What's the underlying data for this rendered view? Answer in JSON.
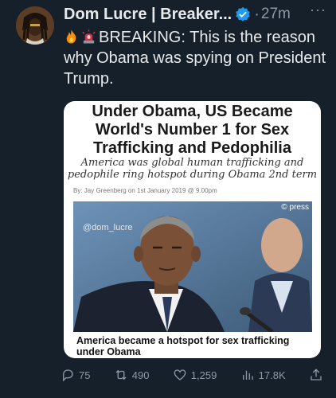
{
  "author": {
    "display_name": "Dom Lucre | Breaker...",
    "time": "27m"
  },
  "tweet": {
    "text": "BREAKING: This is the reason why Obama was spying on President Trump."
  },
  "card": {
    "headline": "Under Obama, US Became World's Number 1 for Sex Trafficking and Pedophilia",
    "subheadline": "America was global human trafficking and pedophile ring hotspot during Obama 2nd term",
    "byline": "By: Jay Greenberg on 1st January 2019 @ 9.00pm",
    "photo_credit": "© press",
    "watermark": "@dom_lucre",
    "caption": "America became a hotspot for sex trafficking under Obama"
  },
  "actions": {
    "replies": "75",
    "reposts": "490",
    "likes": "1,259",
    "views": "17.8K"
  },
  "colors": {
    "background": "#15202b",
    "verified": "#1d9bf0",
    "muted": "#8b98a5"
  }
}
